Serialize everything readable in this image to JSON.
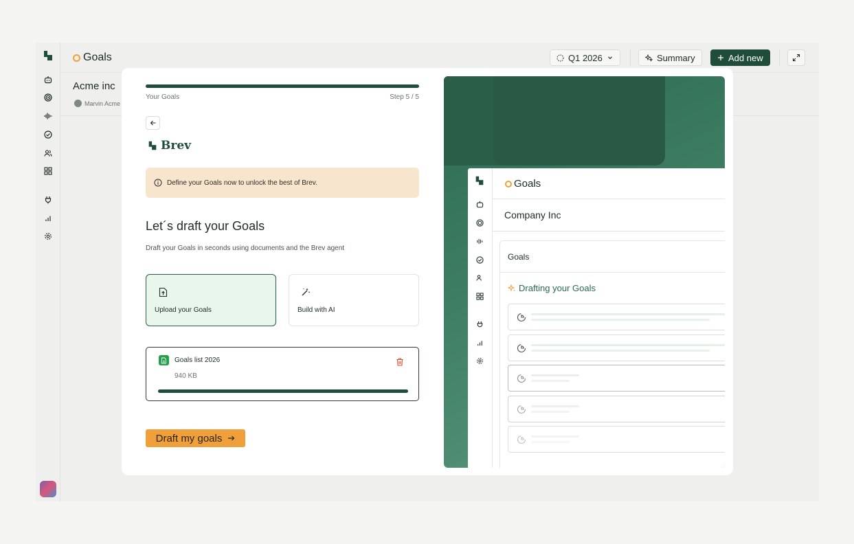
{
  "app": {
    "title": "Goals",
    "org_name": "Acme inc",
    "owner_name": "Marvin Acme",
    "period_label": "Q1 2026",
    "summary_label": "Summary",
    "add_new_label": "Add new",
    "rail_icons": [
      "bot-icon",
      "target-icon",
      "waveform-icon",
      "check-circle-icon",
      "users-icon",
      "grid-icon",
      "plug-icon",
      "bar-chart-icon",
      "settings-icon"
    ]
  },
  "modal": {
    "progress": {
      "label": "Your Goals",
      "step": "Step 5 / 5",
      "fraction": 1.0
    },
    "brand_name": "Brev",
    "notice_text": "Define your Goals now to unlock the best of Brev.",
    "heading": "Let´s draft your Goals",
    "subheading": "Draft your Goals in seconds using documents and the Brev agent",
    "options": [
      {
        "label": "Upload your Goals",
        "icon": "file-upload-icon",
        "selected": true
      },
      {
        "label": "Build with AI",
        "icon": "magic-wand-icon",
        "selected": false
      }
    ],
    "file": {
      "name": "Goals list 2026",
      "size": "940 KB",
      "upload_fraction": 1.0
    },
    "cta_label": "Draft my goals"
  },
  "preview": {
    "title": "Goals",
    "org_name": "Company Inc",
    "panel_title": "Goals",
    "drafting_label": "Drafting your Goals",
    "skeleton_rows": 5
  },
  "colors": {
    "brand_green": "#1f4d3a",
    "accent_orange": "#f0a03a",
    "notice_bg": "#f8e5cd",
    "selected_bg": "#e9f6ec",
    "file_green": "#24a04a",
    "danger": "#d9502a"
  }
}
